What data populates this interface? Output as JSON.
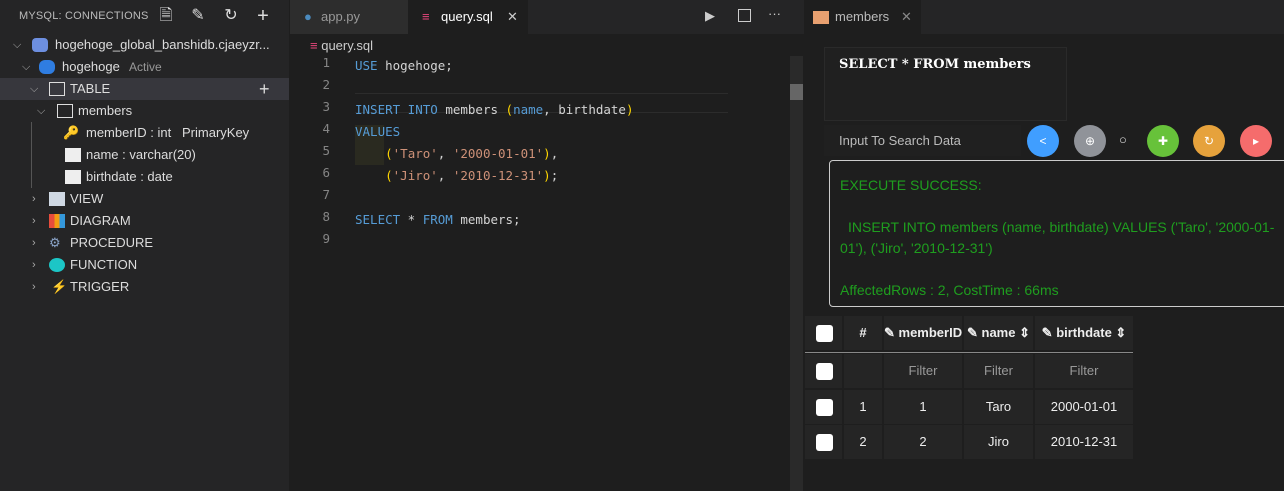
{
  "sidebar": {
    "title": "MYSQL: CONNECTIONS",
    "connection": "hogehoge_global_banshidb.cjaeyzr...",
    "database": "hogehoge",
    "database_status": "Active",
    "table_group": "TABLE",
    "table": "members",
    "columns": [
      {
        "label": "memberID : int",
        "extra": "PrimaryKey"
      },
      {
        "label": "name : varchar(20)"
      },
      {
        "label": "birthdate : date"
      }
    ],
    "groups": [
      "VIEW",
      "DIAGRAM",
      "PROCEDURE",
      "FUNCTION",
      "TRIGGER"
    ]
  },
  "editor": {
    "tabs": [
      "app.py",
      "query.sql"
    ],
    "breadcrumb": "query.sql",
    "line_numbers": [
      "1",
      "2",
      "3",
      "4",
      "5",
      "6",
      "7",
      "8",
      "9"
    ]
  },
  "results": {
    "tab": "members",
    "query": "SELECT * FROM members",
    "search_placeholder": "Input To Search Data",
    "message": {
      "title": "EXECUTE SUCCESS:",
      "sql": "INSERT INTO members (name, birthdate) VALUES ('Taro', '2000-01-01'), ('Jiro', '2010-12-31')",
      "stats": "AffectedRows : 2, CostTime : 66ms"
    },
    "columns": [
      "#",
      "memberID",
      "name",
      "birthdate"
    ],
    "filter": "Filter",
    "rows": [
      [
        "1",
        "1",
        "Taro",
        "2000-01-01"
      ],
      [
        "2",
        "2",
        "Jiro",
        "2010-12-31"
      ]
    ]
  },
  "colors": {
    "success": "#1f9e1f",
    "share": "#409eff",
    "grey": "#909399",
    "green": "#67c23a",
    "orange": "#e6a23c",
    "red": "#f56c6c"
  }
}
